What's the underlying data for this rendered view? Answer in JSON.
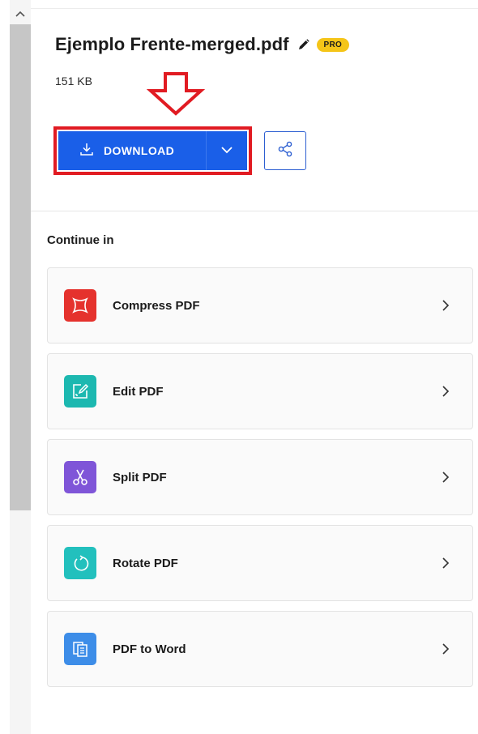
{
  "file": {
    "name": "Ejemplo Frente-merged.pdf",
    "badge": "PRO",
    "size": "151 KB"
  },
  "actions": {
    "download_label": "DOWNLOAD"
  },
  "continue": {
    "heading": "Continue in",
    "tools": [
      {
        "label": "Compress PDF",
        "icon": "compress-icon",
        "color": "#e5322d"
      },
      {
        "label": "Edit PDF",
        "icon": "edit-icon",
        "color": "#1cb8b0"
      },
      {
        "label": "Split PDF",
        "icon": "scissors-icon",
        "color": "#7f55d8"
      },
      {
        "label": "Rotate PDF",
        "icon": "rotate-icon",
        "color": "#22c0bd"
      },
      {
        "label": "PDF to Word",
        "icon": "word-icon",
        "color": "#3d8de8"
      }
    ]
  },
  "colors": {
    "primary": "#1a5fe8",
    "annotation_red": "#e11b22",
    "pro_badge": "#f5c518"
  }
}
